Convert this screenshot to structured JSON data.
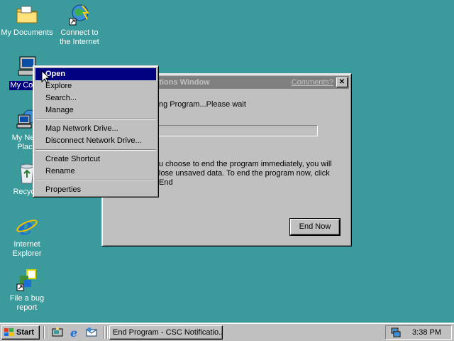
{
  "desktop": {
    "icons": [
      {
        "label": "My Documents",
        "icon": "folder-documents-icon"
      },
      {
        "label": "Connect to the Internet",
        "icon": "connect-internet-icon"
      },
      {
        "label": "My Computer",
        "icon": "my-computer-icon"
      },
      {
        "label": "My Network Places",
        "icon": "network-places-icon"
      },
      {
        "label": "Recycle Bin",
        "icon": "recycle-bin-icon"
      },
      {
        "label": "Internet Explorer",
        "icon": "internet-explorer-icon"
      },
      {
        "label": "File a bug report",
        "icon": "bug-report-icon"
      }
    ],
    "visible_labels": {
      "my_documents": "My Documents",
      "connect_line1": "Connect to",
      "connect_line2": "the Internet",
      "my_computer": "My Comp",
      "network_line1": "My Netw",
      "network_line2": "Place",
      "recycle": "Recycle",
      "ie_line1": "Internet",
      "ie_line2": "Explorer",
      "bug_line1": "File a bug",
      "bug_line2": "report"
    }
  },
  "window": {
    "title": "- CSC Notifications Window",
    "comments_link": "Comments?",
    "close_glyph": "✕",
    "message1": "ng Program...Please wait",
    "progress_percent": 0,
    "message2": "u choose to end the program immediately, you will lose unsaved data. To end the program now, click End",
    "end_now_label": "End Now"
  },
  "context_menu": {
    "items": [
      {
        "label": "Open",
        "highlighted": true
      },
      {
        "label": "Explore"
      },
      {
        "label": "Search..."
      },
      {
        "label": "Manage"
      },
      {
        "label": "Map Network Drive..."
      },
      {
        "label": "Disconnect Network Drive..."
      },
      {
        "label": "Create Shortcut"
      },
      {
        "label": "Rename"
      },
      {
        "label": "Properties"
      }
    ]
  },
  "taskbar": {
    "start_label": "Start",
    "task_button_label": "End Program - CSC Notificatio...",
    "clock": "3:38 PM"
  },
  "colors": {
    "desktop": "#3b9a9c",
    "face": "#c0c0c0",
    "highlight": "#000080",
    "inactive_title": "#808080"
  }
}
